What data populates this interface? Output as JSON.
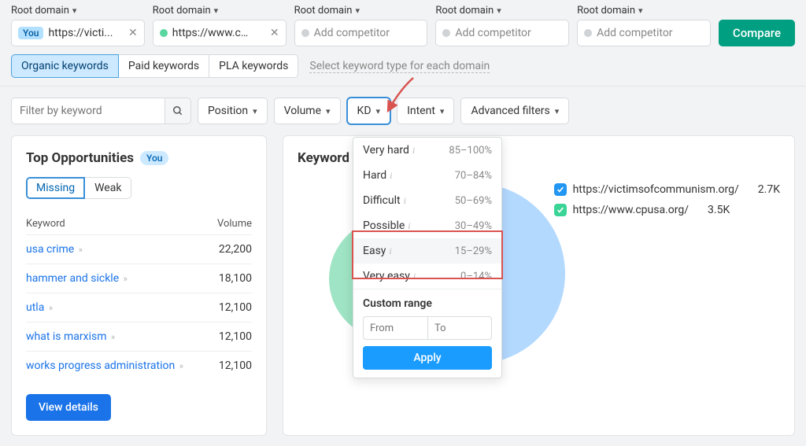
{
  "domains": {
    "label": "Root domain",
    "you_badge": "You",
    "you_url": "https://victi...",
    "comp1_url": "https://www.cpu...",
    "placeholder": "Add competitor",
    "compare": "Compare"
  },
  "kw_types": {
    "organic": "Organic keywords",
    "paid": "Paid keywords",
    "pla": "PLA keywords",
    "hint": "Select keyword type for each domain"
  },
  "filters": {
    "search_placeholder": "Filter by keyword",
    "position": "Position",
    "volume": "Volume",
    "kd": "KD",
    "intent": "Intent",
    "advanced": "Advanced filters"
  },
  "kd_dropdown": {
    "items": [
      {
        "label": "Very hard",
        "range": "85–100%"
      },
      {
        "label": "Hard",
        "range": "70–84%"
      },
      {
        "label": "Difficult",
        "range": "50–69%"
      },
      {
        "label": "Possible",
        "range": "30–49%"
      },
      {
        "label": "Easy",
        "range": "15–29%"
      },
      {
        "label": "Very easy",
        "range": "0–14%"
      }
    ],
    "custom_title": "Custom range",
    "from_placeholder": "From",
    "to_placeholder": "To",
    "apply": "Apply"
  },
  "top_opps": {
    "title": "Top Opportunities",
    "you": "You",
    "missing": "Missing",
    "weak": "Weak",
    "cols": {
      "keyword": "Keyword",
      "volume": "Volume"
    },
    "rows": [
      {
        "kw": "usa crime",
        "vol": "22,200"
      },
      {
        "kw": "hammer and sickle",
        "vol": "18,100"
      },
      {
        "kw": "utla",
        "vol": "12,100"
      },
      {
        "kw": "what is marxism",
        "vol": "12,100"
      },
      {
        "kw": "works progress administration",
        "vol": "12,100"
      }
    ],
    "view_details": "View details"
  },
  "overlap": {
    "title": "Keyword Overlap",
    "legend": [
      {
        "url": "https://victimsofcommunism.org/",
        "count": "2.7K",
        "color": "blue"
      },
      {
        "url": "https://www.cpusa.org/",
        "count": "3.5K",
        "color": "green"
      }
    ]
  }
}
